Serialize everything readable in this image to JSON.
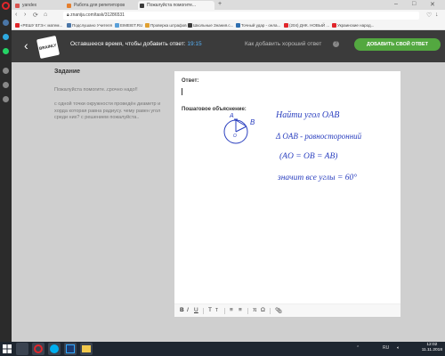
{
  "browser": {
    "tabs": [
      {
        "title": "yandex",
        "fav": "#d9534f"
      },
      {
        "title": "Работа для репетиторов",
        "fav": "#e57f2e"
      },
      {
        "title": "Пожалуйста помогите...",
        "fav": "#3b3b3b"
      }
    ],
    "new_tab": "+",
    "url": "znanija.com/task/31286531",
    "bookmarks": [
      {
        "label": "«РЕШУ ЕГЭ»: матем...",
        "fav": "#e0262b"
      },
      {
        "label": "Подслушано Учителя",
        "fav": "#4a76a8"
      },
      {
        "label": "EIMEIET.RU",
        "fav": "#5aa0d9"
      },
      {
        "label": "Проверка штрафов",
        "fav": "#e0a030"
      },
      {
        "label": "Школьные Знания.c...",
        "fav": "#3b3b3b"
      },
      {
        "label": "Точный удар - онла...",
        "fav": "#2f6fb0"
      },
      {
        "label": "(204) ДНК. НОВЫЙ ...",
        "fav": "#e0262b"
      },
      {
        "label": "Украинские народ...",
        "fav": "#e0262b"
      }
    ]
  },
  "header": {
    "back": "‹",
    "logo": "BRAINLY",
    "time_label": "Оставшееся время, чтобы добавить ответ:",
    "time_value": "19:15",
    "tips": "Как добавить хороший ответ",
    "help": "?",
    "add_button": "ДОБАВИТЬ СВОЙ ОТВЕТ"
  },
  "task": {
    "title": "Задание",
    "line1": "Пожалуйста помогите..срочно надо!!",
    "line2": "с одной точки окружности проведён диаметр и хорда которая равна радиусу. чему равен угол среди них? с решением пожалуйста.."
  },
  "answer": {
    "label": "Ответ:",
    "explanation_label": "Пошаговое объяснение:",
    "handwriting": {
      "point_a": "A",
      "point_b": "B",
      "point_o": "O",
      "line1": "Найти угол OAB",
      "line2": "Δ OAB - равносторонний",
      "line3": "(AO = OB = AB)",
      "line4": "значит все углы = 60°"
    }
  },
  "toolbar": [
    "B",
    "I",
    "U",
    "T",
    "T",
    "≡",
    "≡",
    "π",
    "Ω"
  ],
  "taskbar": {
    "lang": "RU",
    "time": "12:02",
    "date": "11.11.2018"
  }
}
